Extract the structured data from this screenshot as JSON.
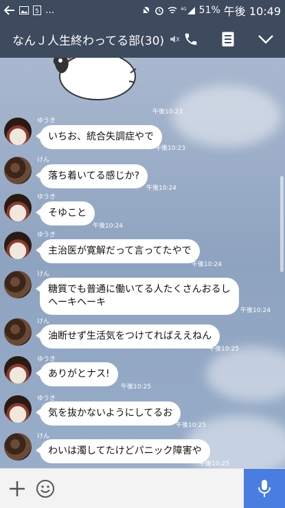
{
  "status_bar": {
    "dots": "...",
    "battery": "51%",
    "time": "午後 10:49"
  },
  "header": {
    "title": "なんＪ人生終わってる部(30)"
  },
  "sticker": {
    "time": "午後10:23"
  },
  "messages": [
    {
      "sender": "ゆうき",
      "avatar": "yuuki",
      "lines": [
        "いちお、統合失調症やで"
      ],
      "time": "午後10:23"
    },
    {
      "sender": "けん",
      "avatar": "ken",
      "lines": [
        "落ち着いてる感じか?"
      ],
      "time": "午後10:24"
    },
    {
      "sender": "ゆうき",
      "avatar": "yuuki",
      "lines": [
        "そゆこと"
      ],
      "time": "午後10:24"
    },
    {
      "sender": "ゆうき",
      "avatar": "yuuki",
      "lines": [
        "主治医が寛解だって言ってたやで"
      ],
      "time": "午後10:24"
    },
    {
      "sender": "けん",
      "avatar": "ken",
      "lines": [
        "糖質でも普通に働いてる人たくさんおるし",
        "ヘーキヘーキ"
      ],
      "time": "午後10:24"
    },
    {
      "sender": "けん",
      "avatar": "ken",
      "lines": [
        "油断せず生活気をつけてればええねん"
      ],
      "time": "午後10:25"
    },
    {
      "sender": "ゆうき",
      "avatar": "yuuki",
      "lines": [
        "ありがとナス!"
      ],
      "time": "午後10:25"
    },
    {
      "sender": "ゆうき",
      "avatar": "yuuki",
      "lines": [
        "気を抜かないようにしてるお"
      ],
      "time": "午後10:25"
    },
    {
      "sender": "けん",
      "avatar": "ken",
      "lines": [
        "わいは濁してたけどパニック障害や"
      ],
      "time": "午後10:25"
    }
  ],
  "icons": {
    "back": "back-arrow-icon",
    "mute": "mute-icon",
    "call": "phone-icon",
    "notes": "notes-icon",
    "menu": "chevron-down-icon",
    "plus": "plus-icon",
    "emoji": "emoji-icon",
    "voice": "microphone-icon"
  },
  "colors": {
    "header": "#3e4a5e",
    "accent": "#4a7de0",
    "bubble": "#ffffff"
  }
}
